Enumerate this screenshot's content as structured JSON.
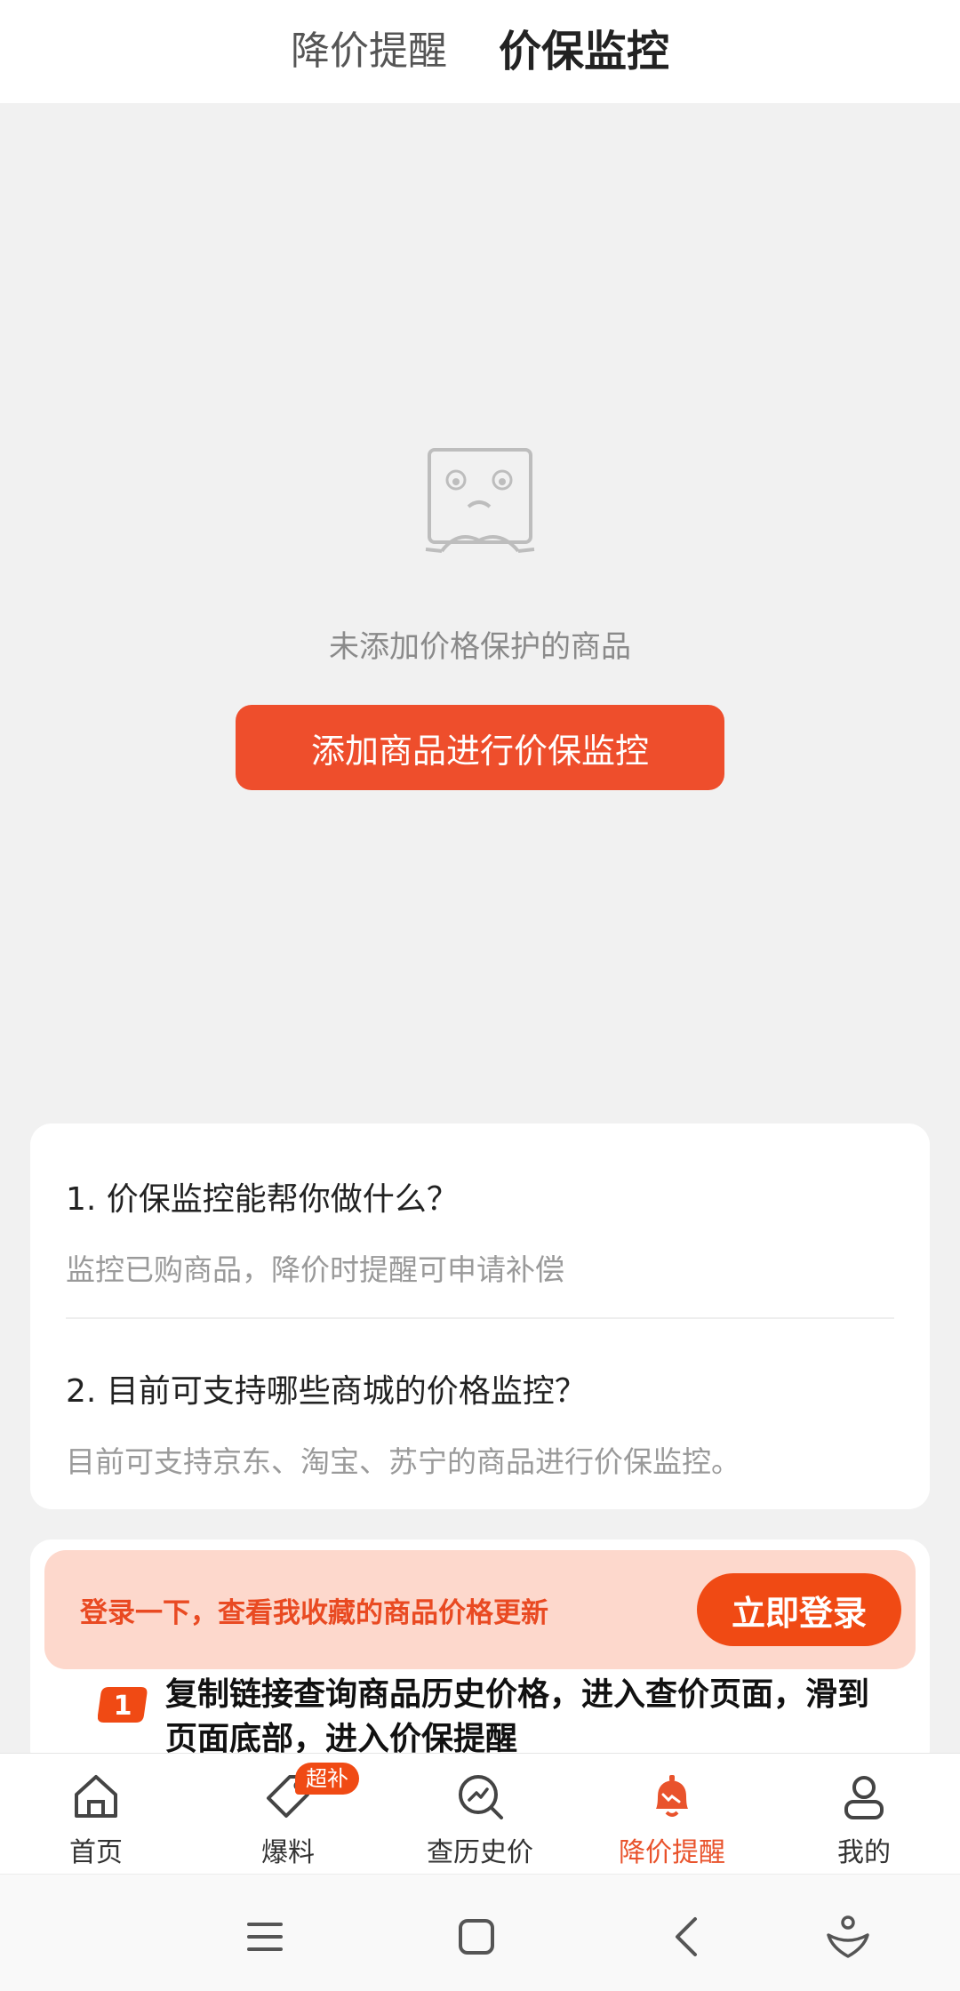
{
  "top_tabs": [
    {
      "label": "降价提醒",
      "active": false
    },
    {
      "label": "价保监控",
      "active": true
    }
  ],
  "empty_state": {
    "icon": "sad-face-box-icon",
    "message": "未添加价格保护的商品",
    "button_label": "添加商品进行价保监控"
  },
  "faq": [
    {
      "question": "1. 价保监控能帮你做什么？",
      "answer": "监控已购商品，降价时提醒可申请补偿"
    },
    {
      "question": "2. 目前可支持哪些商城的价格监控？",
      "answer": "目前可支持京东、淘宝、苏宁的商品进行价保监控。"
    }
  ],
  "login_prompt": {
    "text": "登录一下，查看我收藏的商品价格更新",
    "button_label": "立即登录"
  },
  "step": {
    "number": "1",
    "text": "复制链接查询商品历史价格，进入查价页面，滑到页面底部，进入价保提醒"
  },
  "bottom_nav": [
    {
      "label": "首页",
      "icon": "home-icon",
      "active": false
    },
    {
      "label": "爆料",
      "icon": "tag-icon",
      "active": false,
      "badge": "超补"
    },
    {
      "label": "查历史价",
      "icon": "price-history-search-icon",
      "active": false
    },
    {
      "label": "降价提醒",
      "icon": "bell-icon",
      "active": true
    },
    {
      "label": "我的",
      "icon": "profile-icon",
      "active": false
    }
  ],
  "colors": {
    "accent": "#ee4e2c",
    "banner_bg": "#fdd8cc",
    "background": "#f1f1f1"
  }
}
